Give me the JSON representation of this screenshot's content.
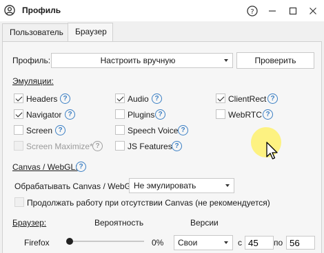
{
  "window": {
    "title": "Профиль",
    "help_icon": "question-circle-icon",
    "controls": [
      "minimize-icon",
      "maximize-icon",
      "close-icon"
    ]
  },
  "tabs": [
    {
      "label": "Пользователь",
      "active": false
    },
    {
      "label": "Браузер",
      "active": true
    }
  ],
  "profile": {
    "label": "Профиль:",
    "selected": "Настроить вручную",
    "check_button": "Проверить"
  },
  "emulations": {
    "title": "Эмуляции:",
    "items": [
      {
        "label": "Headers",
        "checked": true,
        "enabled": true
      },
      {
        "label": "Audio",
        "checked": true,
        "enabled": true
      },
      {
        "label": "ClientRect",
        "checked": true,
        "enabled": true
      },
      {
        "label": "Navigator",
        "checked": true,
        "enabled": true
      },
      {
        "label": "Plugins",
        "checked": false,
        "enabled": true
      },
      {
        "label": "WebRTC",
        "checked": false,
        "enabled": true
      },
      {
        "label": "Screen",
        "checked": false,
        "enabled": true
      },
      {
        "label": "Speech Voice",
        "checked": false,
        "enabled": true
      },
      {
        "label": "Screen Maximize*",
        "checked": false,
        "enabled": false
      },
      {
        "label": "JS Features",
        "checked": false,
        "enabled": true
      }
    ]
  },
  "canvas": {
    "title": "Canvas / WebGL:",
    "process_label": "Обрабатывать Canvas / WebGL",
    "process_value": "Не эмулировать",
    "continue_label": "Продолжать работу при отсутствии Canvas (не рекомендуется)",
    "continue_checked": false
  },
  "browser": {
    "title": "Браузер:",
    "col_probability": "Вероятность",
    "col_versions": "Версии",
    "rows": [
      {
        "name": "Firefox",
        "probability_percent": 0,
        "probability_text": "0%",
        "versions_mode": "Свои",
        "from_label": "с",
        "from_value": "45",
        "to_label": "по",
        "to_value": "56"
      }
    ]
  },
  "colors": {
    "help_icon": "#3b7fc4",
    "highlight": "#fff05a"
  }
}
